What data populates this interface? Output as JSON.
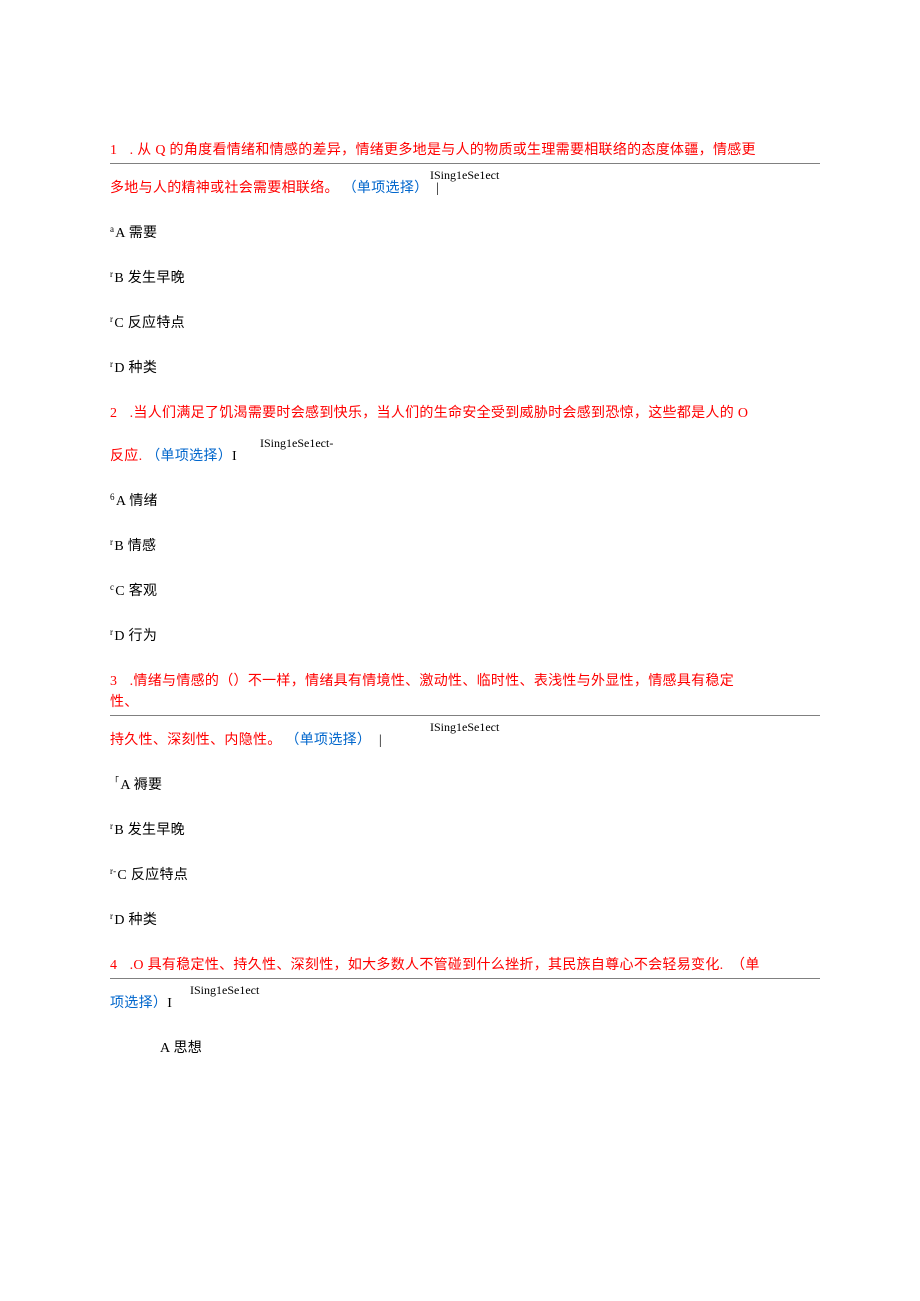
{
  "q1": {
    "num": "1",
    "dot": ".",
    "stem1": "从 Q 的角度看情绪和情感的差异，情绪更多地是与人的物质或生理需要相联络的态度体疆，情感更",
    "tag": "ISing1eSe1ect",
    "stem2a": "多地与人的精神或社会需要相联络。",
    "stem2b": "（单项选择）",
    "bar": "|",
    "A_pre": "a",
    "A": "A 需要",
    "B_pre": "r",
    "B": "B 发生早晚",
    "C_pre": "r",
    "C": "C 反应特点",
    "D_pre": "r",
    "D": "D 种类"
  },
  "q2": {
    "num": "2",
    "dot": ".",
    "stem1": "当人们满足了饥渴需要时会感到快乐，当人们的生命安全受到威胁时会感到恐惊，这些都是人的 O",
    "tag": "ISing1eSe1ect-",
    "stem2a": "反应.",
    "stem2b": "（单项选择）",
    "bar": "I",
    "A_pre": "6",
    "A": "A 情绪",
    "B_pre": "r",
    "B": "B 情感",
    "C_pre": "c",
    "C": "C 客观",
    "D_pre": "r",
    "D": "D 行为"
  },
  "q3": {
    "num": "3",
    "dot": ".",
    "stem1a": "情绪与情感的（）不一样，情绪具有情境性、激动性、临时性、表浅性与外显性，情感具有稳定",
    "stem1b": "性、",
    "tag": "ISing1eSe1ect",
    "stem2a": "持久性、深刻性、内隐性。",
    "stem2b": "（单项选择）",
    "bar": "|",
    "A_pre": "「",
    "A": "A 褥要",
    "B_pre": "r",
    "B": "B 发生早晚",
    "C_pre": "r-",
    "C": "C 反应特点",
    "D_pre": "r",
    "D": "D 种类"
  },
  "q4": {
    "num": "4",
    "dot": ".",
    "stem1": "O 具有稳定性、持久性、深刻性，如大多数人不管碰到什么挫折，其民族自尊心不会轻易变化.",
    "stem1end": "（单",
    "tag": "ISing1eSe1ect",
    "stem2b": "项选择）",
    "bar": "I",
    "A": "A 思想"
  }
}
